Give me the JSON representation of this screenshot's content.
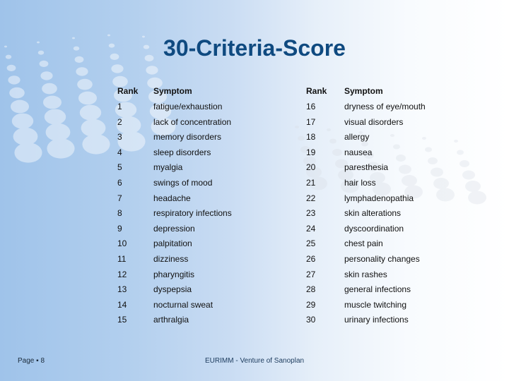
{
  "slide": {
    "title": "30-Criteria-Score",
    "colors": {
      "title": "#0f4a80",
      "background_left": "#9fc3ea",
      "background_right": "#ffffff"
    }
  },
  "table": {
    "headers": {
      "rank": "Rank",
      "symptom": "Symptom"
    },
    "left_rows": [
      {
        "rank": "1",
        "symptom": "fatigue/exhaustion"
      },
      {
        "rank": "2",
        "symptom": "lack of concentration"
      },
      {
        "rank": "3",
        "symptom": "memory disorders"
      },
      {
        "rank": "4",
        "symptom": "sleep disorders"
      },
      {
        "rank": "5",
        "symptom": "myalgia"
      },
      {
        "rank": "6",
        "symptom": "swings of mood"
      },
      {
        "rank": "7",
        "symptom": "headache"
      },
      {
        "rank": "8",
        "symptom": "respiratory infections"
      },
      {
        "rank": "9",
        "symptom": "depression"
      },
      {
        "rank": "10",
        "symptom": "palpitation"
      },
      {
        "rank": "11",
        "symptom": "dizziness"
      },
      {
        "rank": "12",
        "symptom": "pharyngitis"
      },
      {
        "rank": "13",
        "symptom": "dyspepsia"
      },
      {
        "rank": "14",
        "symptom": "nocturnal sweat"
      },
      {
        "rank": "15",
        "symptom": "arthralgia"
      }
    ],
    "right_rows": [
      {
        "rank": "16",
        "symptom": "dryness of eye/mouth"
      },
      {
        "rank": "17",
        "symptom": "visual disorders"
      },
      {
        "rank": "18",
        "symptom": "allergy"
      },
      {
        "rank": "19",
        "symptom": "nausea"
      },
      {
        "rank": "20",
        "symptom": "paresthesia"
      },
      {
        "rank": "21",
        "symptom": "hair loss"
      },
      {
        "rank": "22",
        "symptom": "lymphadenopathia"
      },
      {
        "rank": "23",
        "symptom": "skin alterations"
      },
      {
        "rank": "24",
        "symptom": "dyscoordination"
      },
      {
        "rank": "25",
        "symptom": "chest pain"
      },
      {
        "rank": "26",
        "symptom": "personality changes"
      },
      {
        "rank": "27",
        "symptom": "skin rashes"
      },
      {
        "rank": "28",
        "symptom": "general infections"
      },
      {
        "rank": "29",
        "symptom": "muscle twitching"
      },
      {
        "rank": "30",
        "symptom": "urinary infections"
      }
    ]
  },
  "footer": {
    "page_label": "Page ▪ 8",
    "organization": "EURIMM - Venture of Sanoplan"
  }
}
